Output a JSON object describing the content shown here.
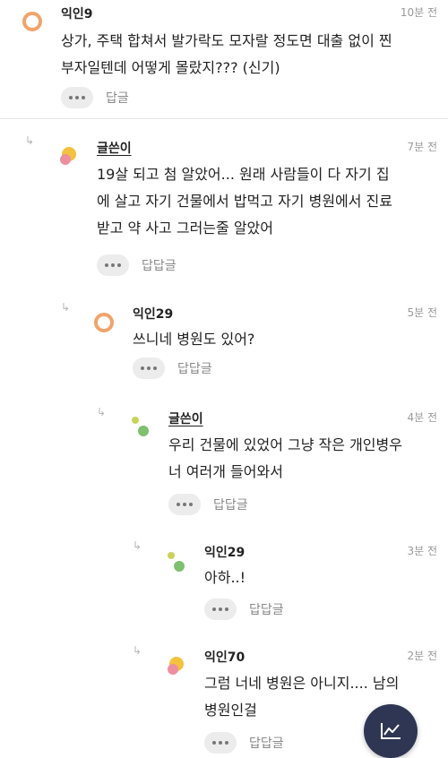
{
  "comments": [
    {
      "name": "익인9",
      "time": "10분 전",
      "lines": [
        "상가, 주택 합쳐서 발가락도 모자랄 정도면 대출 없이 찐",
        "부자일텐데 어떻게 몰랐지??? (신기)"
      ],
      "reply_label": "답글",
      "avatar_icon": "ring-avatar-icon"
    },
    {
      "name": "글쓴이",
      "time": "7분 전",
      "lines": [
        "19살 되고 첨 알았어... 원래 사람들이 다 자기 집",
        "에 살고 자기 건물에서 밥먹고 자기 병원에서 진료",
        "받고 약 사고 그러는줄 알았어"
      ],
      "reply_label": "답답글",
      "avatar_icon": "sun-avatar-icon"
    },
    {
      "name": "익인29",
      "time": "5분 전",
      "lines": [
        "쓰니네 병원도 있어?"
      ],
      "reply_label": "답답글",
      "avatar_icon": "ring-avatar-icon"
    },
    {
      "name": "글쓴이",
      "time": "4분 전",
      "lines": [
        "우리 건물에 있었어 그냥 작은 개인병우",
        "너 여러개 들어와서"
      ],
      "reply_label": "답답글",
      "avatar_icon": "dots-avatar-icon"
    },
    {
      "name": "익인29",
      "time": "3분 전",
      "lines": [
        "아하..!"
      ],
      "reply_label": "답답글",
      "avatar_icon": "dots-avatar-icon"
    },
    {
      "name": "익인70",
      "time": "2분 전",
      "lines": [
        "그럼 너네 병원은 아니지.... 남의",
        "병원인걸"
      ],
      "reply_label": "답답글",
      "avatar_icon": "sun-avatar-icon"
    }
  ],
  "reply_arrow": "↳",
  "fab_icon": "chart-icon",
  "colors": {
    "avatar_orange": "#f0a46a",
    "avatar_yellow": "#f3c23e",
    "avatar_pink": "#ee8fa0",
    "avatar_green": "#7ec06e",
    "avatar_lime": "#c9d35a",
    "fab": "#2f3654"
  }
}
